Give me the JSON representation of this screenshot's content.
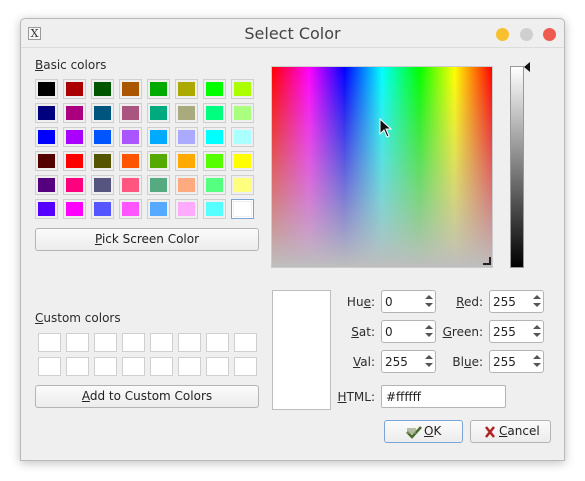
{
  "window": {
    "title": "Select Color",
    "app_icon_glyph": "X"
  },
  "basic_colors": {
    "label_accel": "B",
    "label_rest": "asic colors",
    "rows": [
      [
        "#000000",
        "#aa0000",
        "#005500",
        "#aa5500",
        "#00aa00",
        "#aaaa00",
        "#00ff00",
        "#aaff00"
      ],
      [
        "#00007f",
        "#aa007f",
        "#00557f",
        "#aa557f",
        "#00aa7f",
        "#aaaa7f",
        "#00ff7f",
        "#aaff7f"
      ],
      [
        "#0000ff",
        "#aa00ff",
        "#0055ff",
        "#aa55ff",
        "#00aaff",
        "#aaaaff",
        "#00ffff",
        "#aaffff"
      ],
      [
        "#550000",
        "#ff0000",
        "#555500",
        "#ff5500",
        "#55aa00",
        "#ffaa00",
        "#55ff00",
        "#ffff00"
      ],
      [
        "#55007f",
        "#ff007f",
        "#55557f",
        "#ff557f",
        "#55aa7f",
        "#ffaa7f",
        "#55ff7f",
        "#ffff7f"
      ],
      [
        "#5500ff",
        "#ff00ff",
        "#5555ff",
        "#ff55ff",
        "#55aaff",
        "#ffaaff",
        "#55ffff",
        "#ffffff"
      ]
    ],
    "selected": "#ffffff"
  },
  "pick_button": {
    "accel": "P",
    "rest": "ick Screen Color"
  },
  "custom_colors": {
    "label_accel": "C",
    "label_rest": "ustom colors"
  },
  "add_button": {
    "accel": "A",
    "rest": "dd to Custom Colors"
  },
  "fields": {
    "hue": {
      "pre": "Hu",
      "accel": "e",
      "post": ":",
      "value": "0"
    },
    "sat": {
      "pre": "",
      "accel": "S",
      "post": "at:",
      "value": "0"
    },
    "val": {
      "pre": "",
      "accel": "V",
      "post": "al:",
      "value": "255"
    },
    "red": {
      "pre": "",
      "accel": "R",
      "post": "ed:",
      "value": "255"
    },
    "green": {
      "pre": "",
      "accel": "G",
      "post": "reen:",
      "value": "255"
    },
    "blue": {
      "pre": "Bl",
      "accel": "u",
      "post": "e:",
      "value": "255"
    },
    "html": {
      "pre": "",
      "accel": "H",
      "post": "TML:",
      "value": "#ffffff"
    }
  },
  "buttons": {
    "ok": {
      "accel": "O",
      "rest": "K"
    },
    "cancel": {
      "accel": "C",
      "rest": "ancel"
    }
  },
  "preview_color": "#ffffff"
}
